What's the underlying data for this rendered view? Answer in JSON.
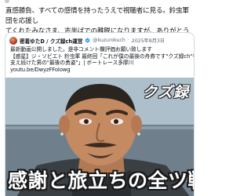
{
  "post": {
    "intro_lines": [
      "直感勝負、すべての感情を持ったうえで視聴者に見る。鈴虫軍団を応援し",
      "てくれたみなさま、志半ばでの離脱になりますが、ありがとうございまし",
      "た。"
    ]
  },
  "quote": {
    "author_name": "密着ゆたD / クズ録ch運営",
    "handle": "@kuzurokuch",
    "separator": "·",
    "date": "2025年8月3日",
    "text_lines": [
      "最新動画公開しました。是非コメント欄評価お願い致します",
      "【惑星】ジ・ソビエト 鈴虫軍 最終回「これが僕の最後の舟券です\"クズ録ch\"を",
      "支え続けた男の\"最後の勇姿\"」| ボートレース多摩川",
      "youtu.be/DwyzFFoIowg"
    ]
  },
  "media": {
    "logo_text": "クズ録",
    "caption": "感謝と旅立ちの全ツ戦"
  },
  "colors": {
    "border": "#cfd9de",
    "verified": "#1d9bf0",
    "text_primary": "#0f1419",
    "text_secondary": "#536471"
  }
}
